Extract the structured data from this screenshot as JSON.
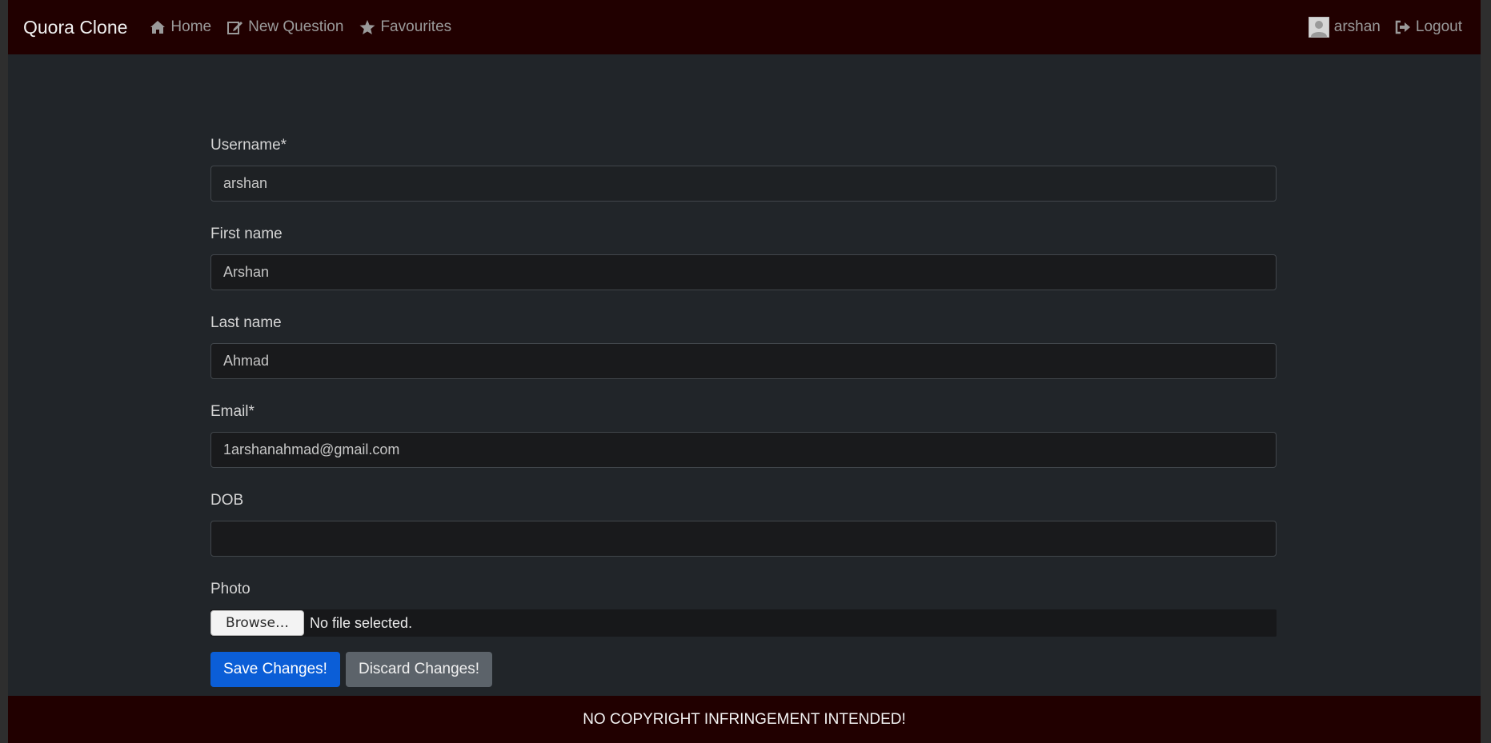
{
  "navbar": {
    "brand": "Quora Clone",
    "links": [
      {
        "label": "Home",
        "icon": "home-icon"
      },
      {
        "label": "New Question",
        "icon": "edit-icon"
      },
      {
        "label": "Favourites",
        "icon": "star-icon"
      }
    ],
    "user": {
      "name": "arshan",
      "avatar_icon": "avatar-icon"
    },
    "logout_label": "Logout",
    "logout_icon": "sign-out-icon",
    "background_color": "#210000"
  },
  "form": {
    "username": {
      "label": "Username*",
      "value": "arshan"
    },
    "first_name": {
      "label": "First name",
      "value": "Arshan"
    },
    "last_name": {
      "label": "Last name",
      "value": "Ahmad"
    },
    "email": {
      "label": "Email*",
      "value": "1arshanahmad@gmail.com"
    },
    "dob": {
      "label": "DOB",
      "value": ""
    },
    "photo": {
      "label": "Photo",
      "browse_label": "Browse…",
      "status": "No file selected."
    },
    "save_label": "Save Changes!",
    "discard_label": "Discard Changes!"
  },
  "footer": {
    "text": "NO COPYRIGHT INFRINGEMENT INTENDED!"
  },
  "colors": {
    "primary": "#0b5ed7",
    "secondary": "#5c636a",
    "page_bg": "#212529"
  }
}
